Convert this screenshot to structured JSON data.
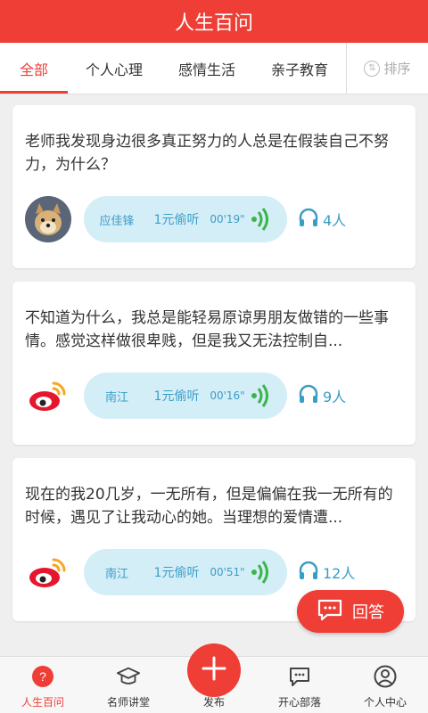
{
  "header": {
    "title": "人生百问"
  },
  "tabs": [
    {
      "label": "全部",
      "active": true
    },
    {
      "label": "个人心理"
    },
    {
      "label": "感情生活"
    },
    {
      "label": "亲子教育"
    }
  ],
  "sort": {
    "icon": "sort-icon",
    "label": "排序"
  },
  "questions": [
    {
      "text": "老师我发现身边很多真正努力的人总是在假装自己不努力，为什么？",
      "avatar": "photo-avatar",
      "answerer": "应佳锋",
      "price": "1元偷听",
      "duration": "00'19\"",
      "listeners": "4人"
    },
    {
      "text": "不知道为什么，我总是能轻易原谅男朋友做错的一些事情。感觉这样做很卑贱，但是我又无法控制自...",
      "avatar": "weibo-icon",
      "answerer": "南江",
      "price": "1元偷听",
      "duration": "00'16\"",
      "listeners": "9人"
    },
    {
      "text": "现在的我20几岁，一无所有，但是偏偏在我一无所有的时候，遇见了让我动心的她。当理想的爱情遭...",
      "avatar": "weibo-icon",
      "answerer": "南江",
      "price": "1元偷听",
      "duration": "00'51\"",
      "listeners": "12人"
    }
  ],
  "answer_button": {
    "label": "回答",
    "icon": "chat-bubble-icon"
  },
  "bottom_nav": [
    {
      "label": "人生百问",
      "icon": "question-circle-icon",
      "active": true
    },
    {
      "label": "名师讲堂",
      "icon": "graduation-cap-icon"
    },
    {
      "label": "发布",
      "icon": "plus-icon"
    },
    {
      "label": "开心部落",
      "icon": "chat-icon"
    },
    {
      "label": "个人中心",
      "icon": "user-icon"
    }
  ],
  "colors": {
    "accent": "#ee3e36",
    "voice_bg": "#d4eef8",
    "voice_text": "#3a9dc6"
  }
}
